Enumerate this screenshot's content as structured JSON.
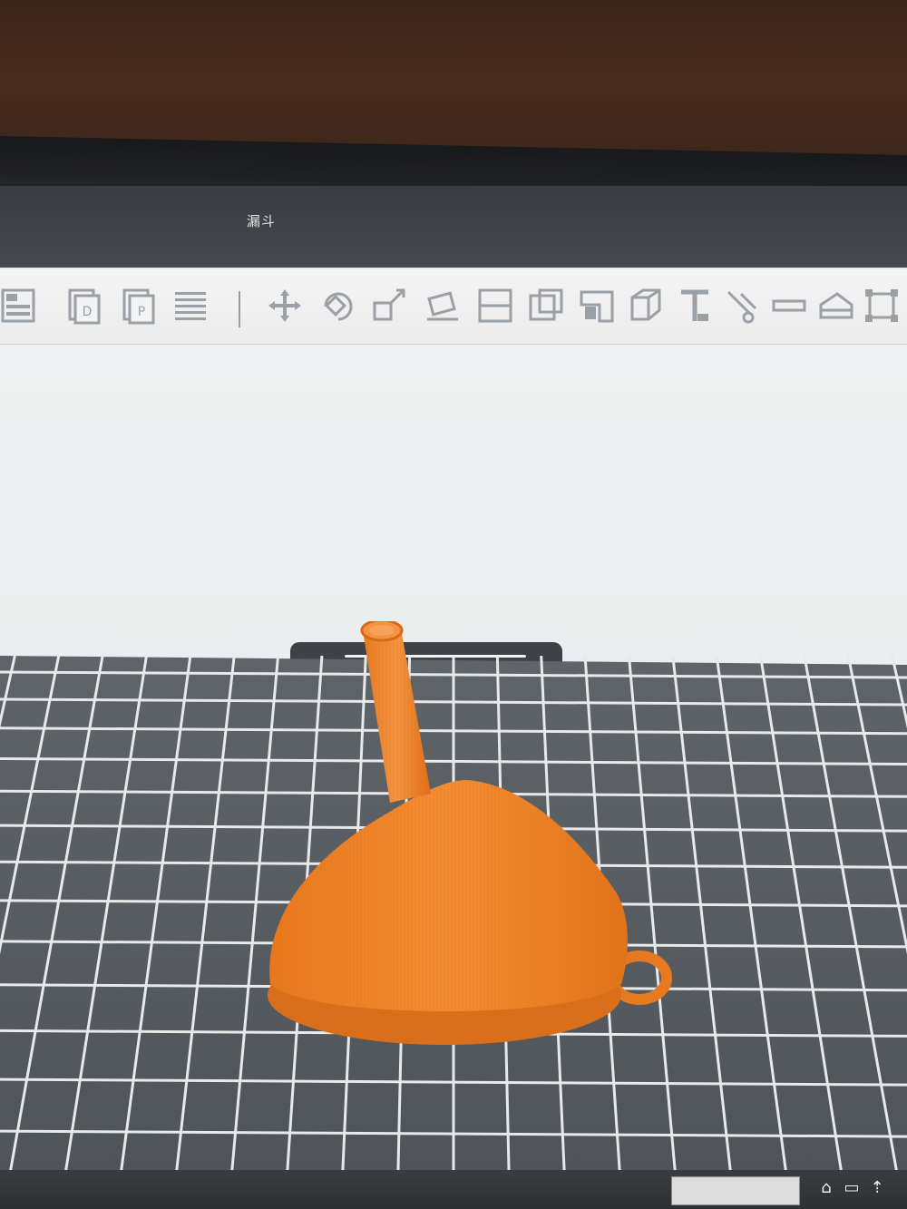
{
  "window": {
    "title": "漏斗"
  },
  "toolbar": {
    "tools": [
      "layout-icon",
      "copy-icon",
      "paste-icon",
      "list-icon",
      "move-icon",
      "rotate-icon",
      "scale-icon",
      "tilt-icon",
      "split-icon",
      "cut-icon",
      "corner-icon",
      "cube-icon",
      "text-icon",
      "support-icon",
      "line-icon",
      "cup-icon",
      "frame-icon"
    ]
  },
  "model": {
    "color": "#f0862a",
    "shadow_color": "#d96f1a"
  },
  "bed": {
    "color": "#595e63",
    "grid_color": "#e7e9ea"
  }
}
